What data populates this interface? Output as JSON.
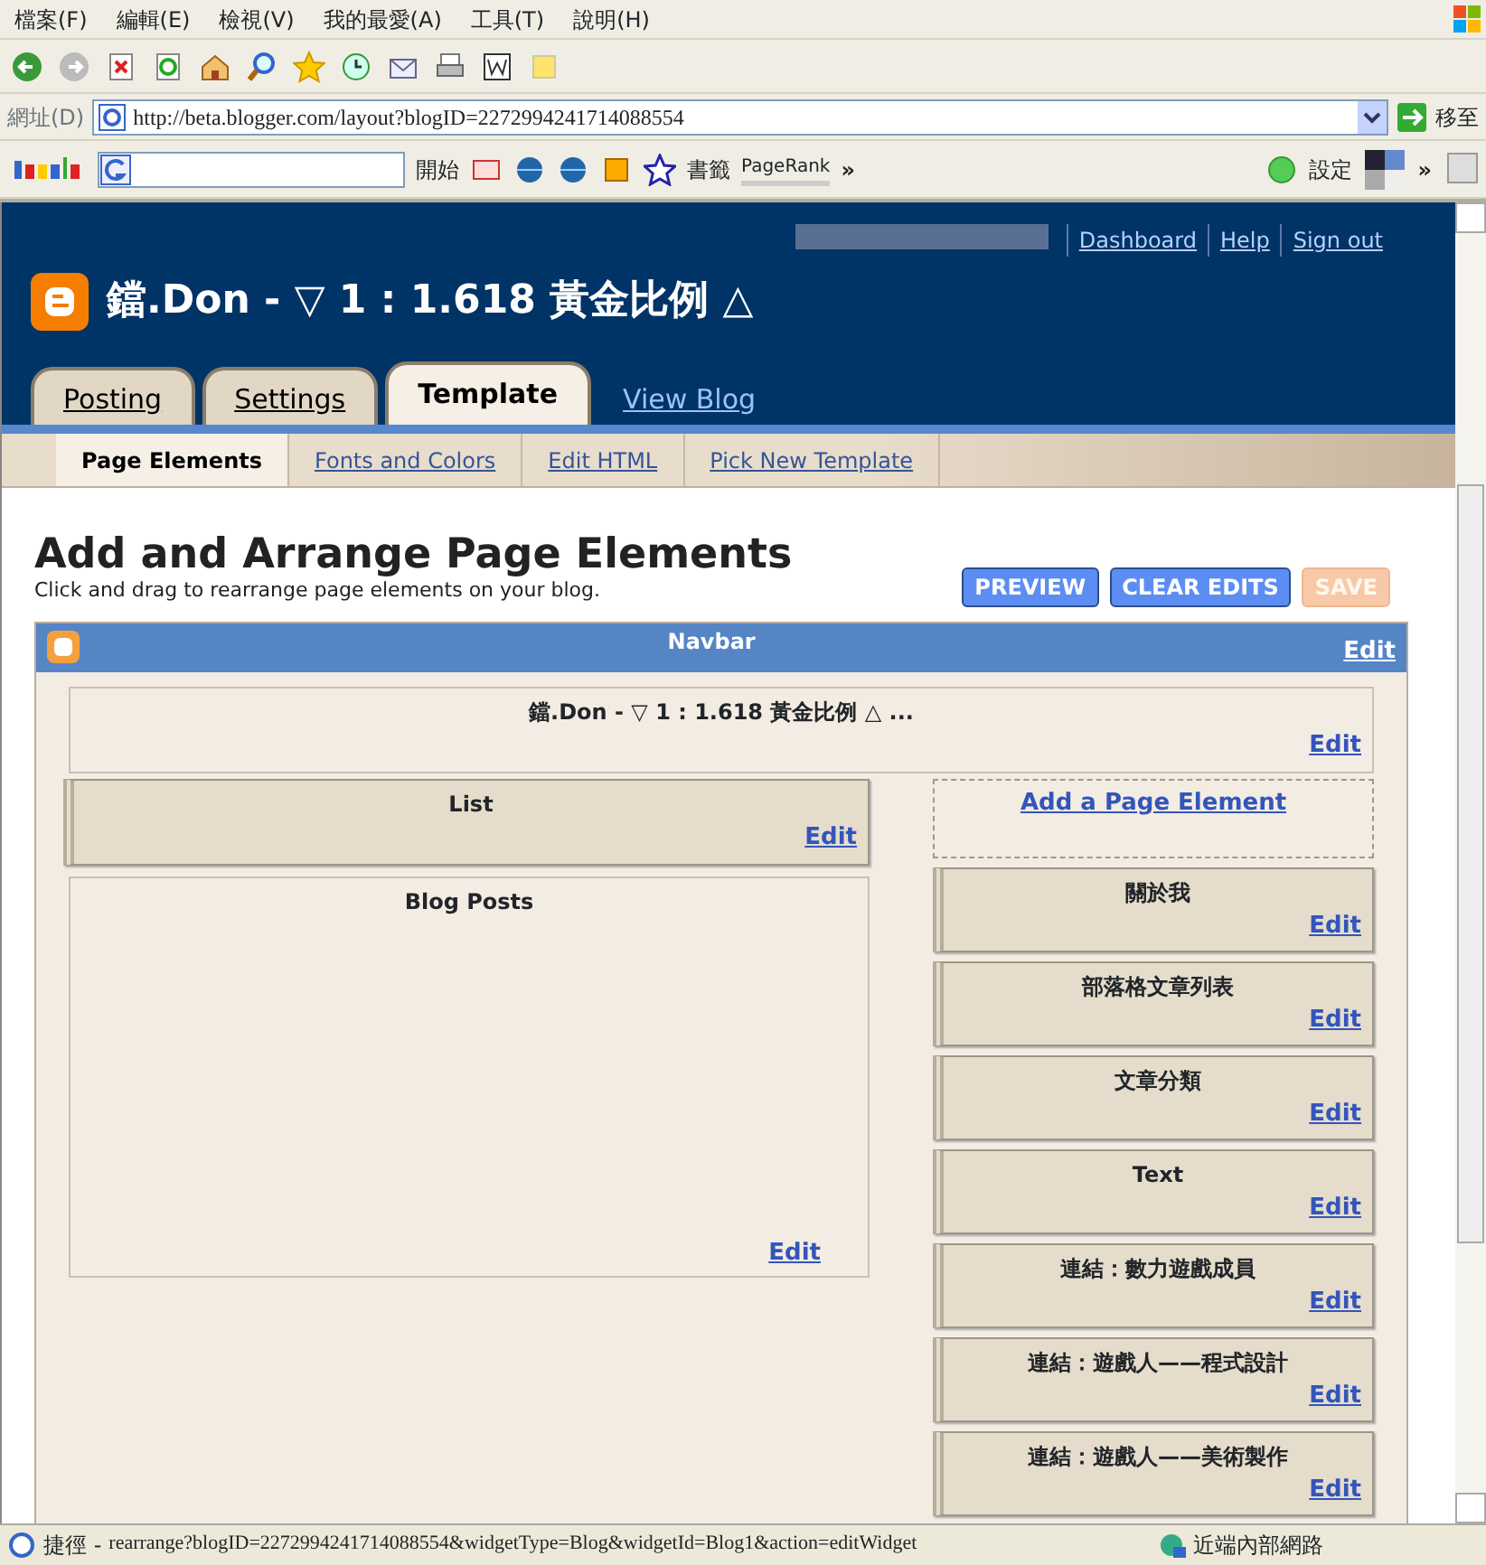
{
  "menu": [
    "檔案(F)",
    "編輯(E)",
    "檢視(V)",
    "我的最愛(A)",
    "工具(T)",
    "說明(H)"
  ],
  "address": {
    "label": "網址(D)",
    "url": "http://beta.blogger.com/layout?blogID=2272994241714088554",
    "go": "移至"
  },
  "google_toolbar": {
    "start": "開始",
    "bookmarks": "書籤",
    "pagerank": "PageRank",
    "more": "»",
    "settings": "設定",
    "more_right": "»"
  },
  "header": {
    "links": [
      "Dashboard",
      "Help",
      "Sign out"
    ],
    "blog_title": "鐺.Don - ▽ 1 : 1.618 黃金比例 △"
  },
  "tabs": [
    {
      "label": "Posting",
      "selected": false
    },
    {
      "label": "Settings",
      "selected": false
    },
    {
      "label": "Template",
      "selected": true
    }
  ],
  "view_blog": "View Blog",
  "subtabs": [
    {
      "label": "Page Elements",
      "selected": true
    },
    {
      "label": "Fonts and Colors",
      "selected": false
    },
    {
      "label": "Edit HTML",
      "selected": false
    },
    {
      "label": "Pick New Template",
      "selected": false
    }
  ],
  "page_title": "Add and Arrange Page Elements",
  "page_subtitle": "Click and drag to rearrange page elements on your blog.",
  "buttons": [
    {
      "label": "PREVIEW",
      "disabled": false
    },
    {
      "label": "CLEAR EDITS",
      "disabled": false
    },
    {
      "label": "SAVE",
      "disabled": true
    }
  ],
  "navbar": {
    "title": "Navbar",
    "edit": "Edit"
  },
  "header_widget": {
    "title": "鐺.Don - ▽ 1 : 1.618 黃金比例 △ ...",
    "edit": "Edit"
  },
  "main_widgets": [
    {
      "kind": "widget",
      "title": "List",
      "edit": "Edit"
    },
    {
      "kind": "posts",
      "title": "Blog Posts",
      "edit": "Edit"
    }
  ],
  "add_element": "Add a Page Element",
  "sidebar_widgets": [
    {
      "title": "關於我",
      "edit": "Edit"
    },
    {
      "title": "部落格文章列表",
      "edit": "Edit"
    },
    {
      "title": "文章分類",
      "edit": "Edit"
    },
    {
      "title": "Text",
      "edit": "Edit"
    },
    {
      "title": "連結：數力遊戲成員",
      "edit": "Edit"
    },
    {
      "title": "連結：遊戲人——程式設計",
      "edit": "Edit"
    },
    {
      "title": "連結：遊戲人——美術製作",
      "edit": "Edit"
    }
  ],
  "status_bar": {
    "prefix": "捷徑 -",
    "url": "rearrange?blogID=2272994241714088554&widgetType=Blog&widgetId=Blog1&action=editWidget",
    "zone": "近端內部網路"
  }
}
